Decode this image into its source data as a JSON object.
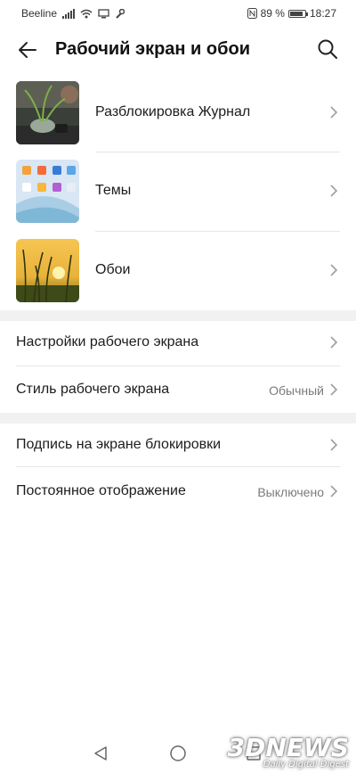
{
  "status_bar": {
    "carrier": "Beeline",
    "battery_percent": "89 %",
    "time": "18:27",
    "battery_level": 0.89
  },
  "header": {
    "title": "Рабочий экран и обои"
  },
  "image_items": [
    {
      "label": "Разблокировка Журнал",
      "icon": "unlock-magazine-thumbnail"
    },
    {
      "label": "Темы",
      "icon": "themes-thumbnail"
    },
    {
      "label": "Обои",
      "icon": "wallpaper-thumbnail"
    }
  ],
  "settings_group1": [
    {
      "label": "Настройки рабочего экрана",
      "value": ""
    },
    {
      "label": "Стиль рабочего экрана",
      "value": "Обычный"
    }
  ],
  "settings_group2": [
    {
      "label": "Подпись на экране блокировки",
      "value": ""
    },
    {
      "label": "Постоянное отображение",
      "value": "Выключено"
    }
  ],
  "watermark": {
    "main": "3DNEWS",
    "sub": "Daily Digital Digest"
  },
  "colors": {
    "section_gap": "#f1f1f1",
    "value_text": "#7a7a7a",
    "chevron": "#9e9e9e"
  }
}
